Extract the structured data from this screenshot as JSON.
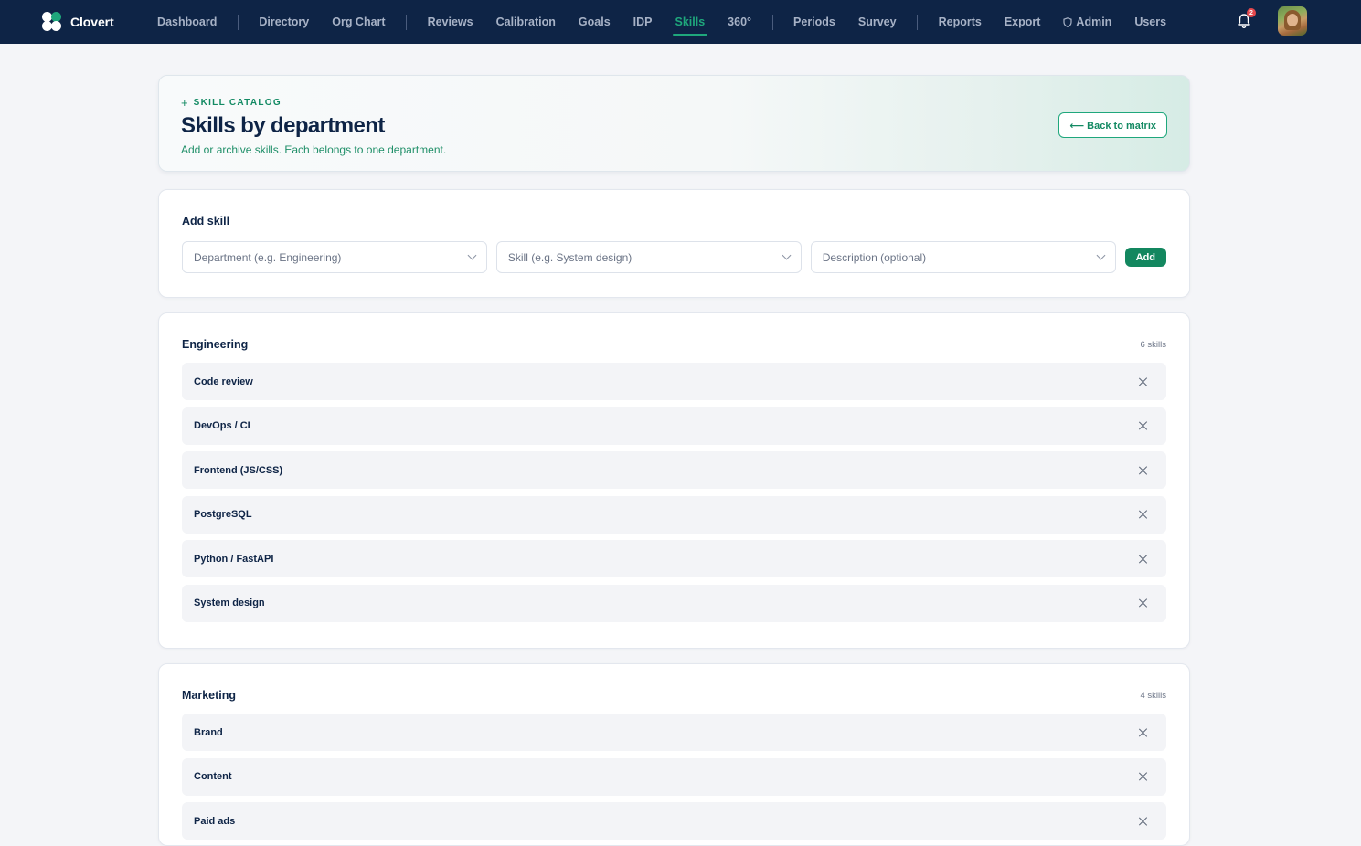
{
  "nav": {
    "brand": "Clovert",
    "items": [
      {
        "label": "Dashboard"
      },
      {
        "label": "Directory"
      },
      {
        "label": "Org Chart"
      },
      {
        "label": "Reviews"
      },
      {
        "label": "Calibration"
      },
      {
        "label": "Goals"
      },
      {
        "label": "IDP"
      },
      {
        "label": "Skills",
        "active": true
      },
      {
        "label": "360°"
      },
      {
        "label": "Periods"
      },
      {
        "label": "Survey"
      },
      {
        "label": "Reports"
      },
      {
        "label": "Export"
      },
      {
        "label": "Admin",
        "icon": "shield-icon"
      },
      {
        "label": "Users"
      }
    ],
    "notification_count": "2",
    "colors": {
      "bg": "#0e2446",
      "active": "#1fa77c",
      "inactive": "#a7b2c6"
    }
  },
  "header": {
    "eyebrow": "SKILL CATALOG",
    "title": "Skills by department",
    "subtitle": "Add or archive skills. Each belongs to one department.",
    "back_label": "⟵ Back to matrix"
  },
  "add_skill": {
    "title": "Add skill",
    "department_placeholder": "Department (e.g. Engineering)",
    "skill_placeholder": "Skill (e.g. System design)",
    "description_placeholder": "Description (optional)",
    "add_label": "Add"
  },
  "departments": [
    {
      "name": "Engineering",
      "count": "6 skills",
      "skills": [
        "Code review",
        "DevOps / CI",
        "Frontend (JS/CSS)",
        "PostgreSQL",
        "Python / FastAPI",
        "System design"
      ]
    },
    {
      "name": "Marketing",
      "count": "4 skills",
      "skills": [
        "Brand",
        "Content",
        "Paid ads"
      ]
    }
  ],
  "colors": {
    "accent": "#13875f",
    "page_bg": "#f4f5f8",
    "row_bg": "#f3f4f7"
  }
}
